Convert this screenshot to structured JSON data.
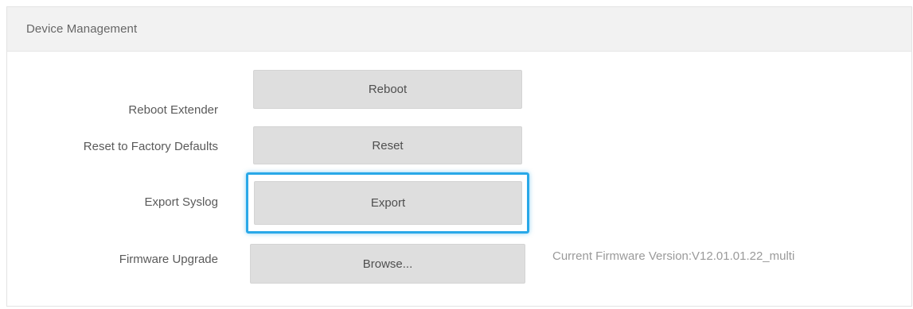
{
  "panel": {
    "title": "Device Management"
  },
  "rows": [
    {
      "label": "Reboot Extender",
      "button": "Reboot"
    },
    {
      "label": "Reset to Factory Defaults",
      "button": "Reset"
    },
    {
      "label": "Export Syslog",
      "button": "Export"
    },
    {
      "label": "Firmware Upgrade",
      "button": "Browse..."
    }
  ],
  "firmware": {
    "current_version_text": "Current Firmware Version:V12.01.01.22_multi"
  },
  "colors": {
    "focus_ring": "#29a8e8",
    "button_bg": "#dedede",
    "header_bg": "#f2f2f2"
  }
}
